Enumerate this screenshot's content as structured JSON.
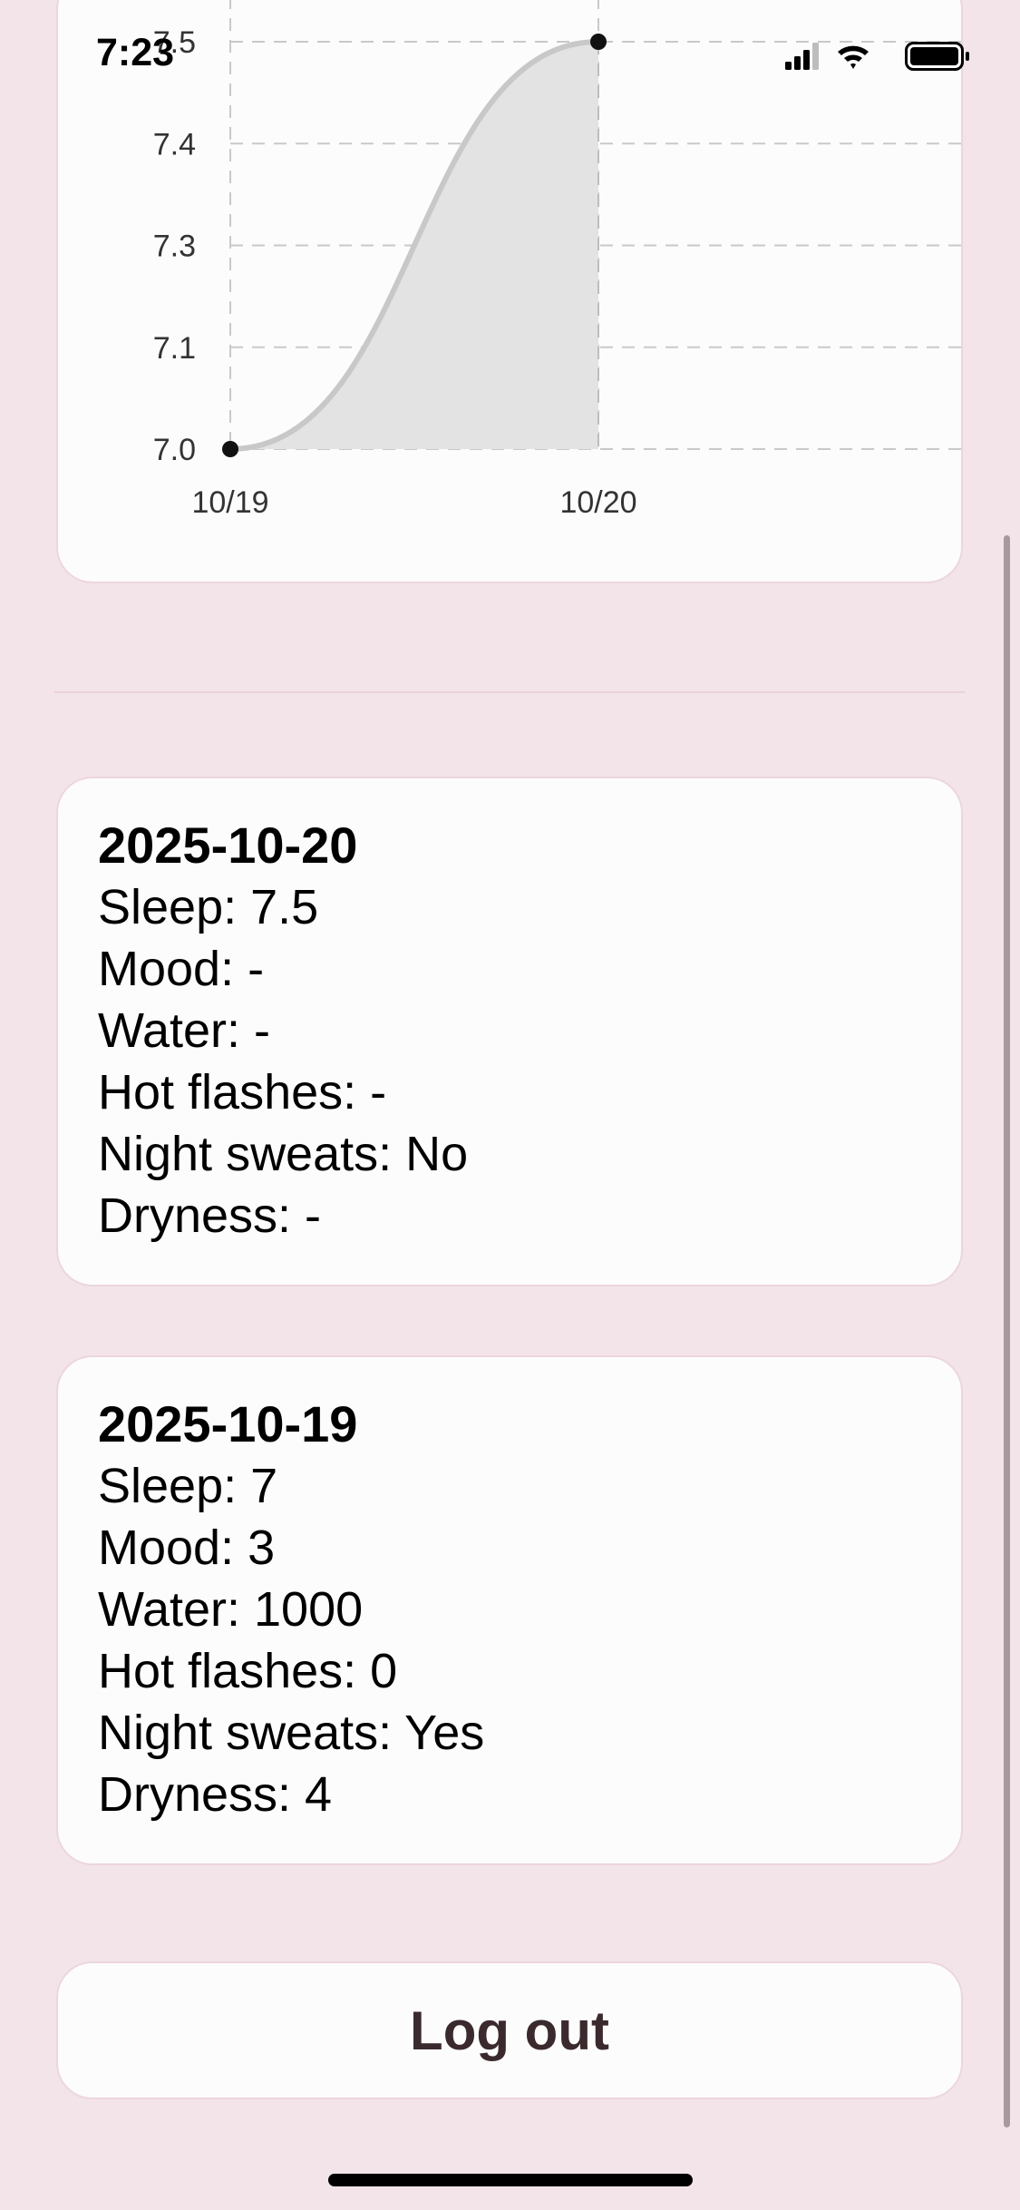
{
  "status_bar": {
    "time": "7:23",
    "icons": [
      "signal-icon",
      "wifi-icon",
      "battery-icon"
    ]
  },
  "chart_data": {
    "type": "area",
    "x": [
      "10/19",
      "10/20"
    ],
    "series": [
      {
        "values": [
          7.0,
          7.5
        ]
      }
    ],
    "y_tick_labels": [
      "7.0",
      "7.1",
      "7.3",
      "7.4",
      "7.5"
    ],
    "x_tick_labels": [
      "10/19",
      "10/20"
    ],
    "ylim": [
      7.0,
      7.5
    ],
    "grid": true,
    "line_color": "#c8c8c8",
    "fill_color": "#e3e3e3",
    "point_color": "#111111"
  },
  "entries": [
    {
      "date": "2025-10-20",
      "sleep": "Sleep: 7.5",
      "mood": "Mood: -",
      "water": "Water: -",
      "hot_flashes": "Hot flashes: -",
      "night_sweats": "Night sweats: No",
      "dryness": "Dryness: -"
    },
    {
      "date": "2025-10-19",
      "sleep": "Sleep: 7",
      "mood": "Mood: 3",
      "water": "Water: 1000",
      "hot_flashes": "Hot flashes: 0",
      "night_sweats": "Night sweats: Yes",
      "dryness": "Dryness: 4"
    }
  ],
  "logout": {
    "label": "Log out"
  },
  "colors": {
    "background": "#f3e4e9",
    "card": "#fdfcfc",
    "card_border": "#ecd6dd",
    "button_text": "#3a2a2e"
  }
}
